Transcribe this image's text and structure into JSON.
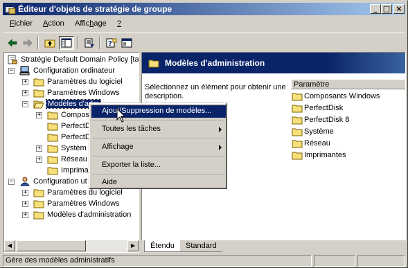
{
  "window": {
    "title": "Éditeur d'objets de stratégie de groupe",
    "controls": {
      "minimize": "_",
      "maximize": "□",
      "close": "×"
    }
  },
  "menubar": {
    "items": [
      {
        "label": "Fichier",
        "accel": "F"
      },
      {
        "label": "Action",
        "accel": "A"
      },
      {
        "label": "Affichage",
        "accel": "h"
      },
      {
        "label": "?",
        "accel": "?"
      }
    ]
  },
  "toolbar": {
    "buttons": [
      "back-arrow-icon",
      "forward-arrow-icon",
      "up-folder-icon",
      "show-tree-icon",
      "export-list-icon",
      "help-icon",
      "console-window-icon"
    ]
  },
  "tree": {
    "root": "Stratégie Default Domain Policy [ta",
    "computer_config": "Configuration ordinateur",
    "computer_children": [
      "Paramètres du logiciel",
      "Paramètres Windows",
      "Modèles d'administration"
    ],
    "admin_children": [
      "Composants Windows",
      "PerfectDisk",
      "PerfectDisk 8",
      "Système",
      "Réseau",
      "Imprimantes"
    ],
    "admin_children_visible": [
      "Compos",
      "PerfectD",
      "PerfectD",
      "Systèm",
      "Réseau",
      "Imprima"
    ],
    "user_config": "Configuration ut",
    "user_children": [
      "Paramètres du logiciel",
      "Paramètres Windows",
      "Modèles d'administration"
    ],
    "selected_label": "Modèles d'adm"
  },
  "right_pane": {
    "header_title": "Modèles d'administration",
    "description": "Sélectionnez un élément pour obtenir une description.",
    "column_header": "Paramètre",
    "items": [
      "Composants Windows",
      "PerfectDisk",
      "PerfectDisk 8",
      "Système",
      "Réseau",
      "Imprimantes"
    ]
  },
  "tabs": {
    "extended": "Étendu",
    "standard": "Standard"
  },
  "context_menu": {
    "items": [
      {
        "label": "Ajout/Suppression de modèles...",
        "highlighted": true
      },
      {
        "label": "Toutes les tâches",
        "submenu": true
      },
      {
        "label": "Affichage",
        "submenu": true
      },
      {
        "label": "Exporter la liste..."
      },
      {
        "label": "Aide"
      }
    ]
  },
  "statusbar": {
    "text": "Gère des modèles administratifs"
  },
  "colors": {
    "title_active": "#0a246a",
    "title_gradient_end": "#a6caf0",
    "face": "#d4d0c8",
    "highlight": "#0a246a",
    "folder": "#f5e07a"
  }
}
